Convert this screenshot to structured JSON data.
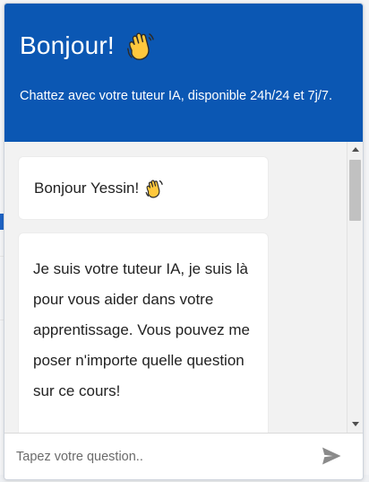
{
  "header": {
    "title": "Bonjour!",
    "title_icon": "waving-hand-icon",
    "subtitle": "Chattez avec votre tuteur IA, disponible 24h/24 et 7j/7."
  },
  "messages": [
    {
      "sender": "bot",
      "text": "Bonjour Yessin!",
      "icon": "waving-hand-icon"
    },
    {
      "sender": "bot",
      "text": "Je suis votre tuteur IA, je suis là pour vous aider dans votre apprentissage. Vous pouvez me poser n'importe quelle question sur ce cours!"
    }
  ],
  "composer": {
    "placeholder": "Tapez votre question..",
    "value": "",
    "send_icon": "send-icon"
  },
  "colors": {
    "header_bg": "#0b57b3",
    "header_text": "#ffffff",
    "messages_bg": "#f2f2f2",
    "bubble_bg": "#ffffff",
    "send_icon": "#8a8a8a"
  }
}
